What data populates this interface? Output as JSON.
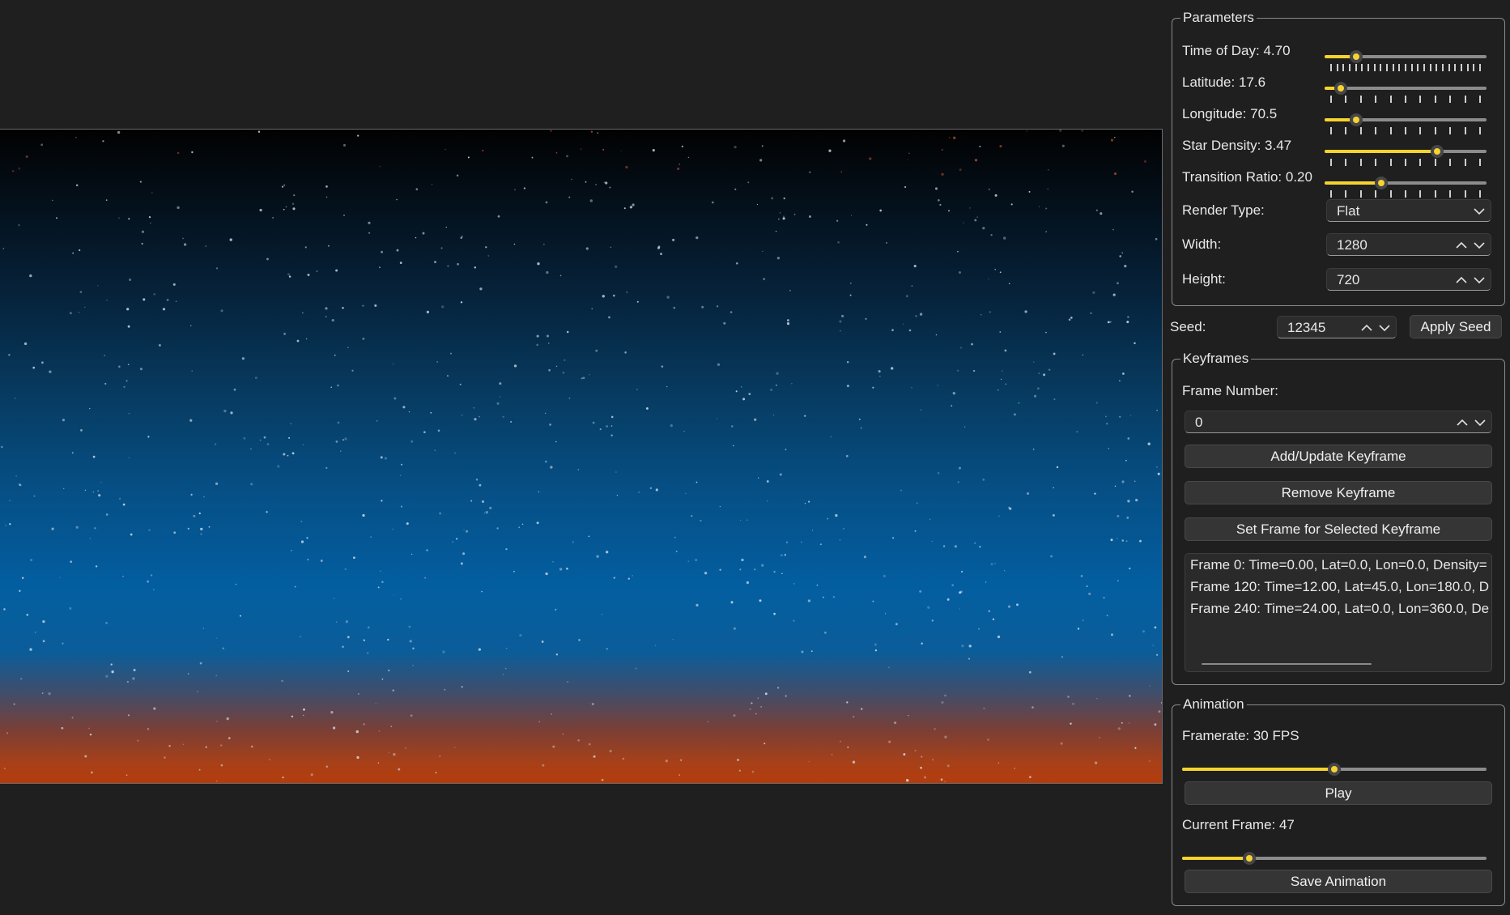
{
  "parameters": {
    "title": "Parameters",
    "sliders": [
      {
        "label": "Time of Day: 4.70",
        "value": 0.196,
        "ticks": 25
      },
      {
        "label": "Latitude: 17.6",
        "value": 0.098,
        "ticks": 11
      },
      {
        "label": "Longitude: 70.5",
        "value": 0.196,
        "ticks": 11
      },
      {
        "label": "Star Density: 3.47",
        "value": 0.694,
        "ticks": 11
      },
      {
        "label": "Transition Ratio: 0.20",
        "value": 0.35,
        "ticks": 11
      }
    ],
    "render_type": {
      "label": "Render Type:",
      "value": "Flat"
    },
    "width": {
      "label": "Width:",
      "value": "1280"
    },
    "height": {
      "label": "Height:",
      "value": "720"
    }
  },
  "seed": {
    "label": "Seed:",
    "value": "12345",
    "apply_label": "Apply Seed"
  },
  "keyframes": {
    "title": "Keyframes",
    "frame_number_label": "Frame Number:",
    "frame_number_value": "0",
    "add_update_label": "Add/Update Keyframe",
    "remove_label": "Remove Keyframe",
    "set_frame_label": "Set Frame for Selected Keyframe",
    "list": [
      "Frame 0: Time=0.00, Lat=0.0, Lon=0.0, Density=",
      "Frame 120: Time=12.00, Lat=45.0, Lon=180.0, D",
      "Frame 240: Time=24.00, Lat=0.0, Lon=360.0, De"
    ]
  },
  "animation": {
    "title": "Animation",
    "framerate_label": "Framerate: 30 FPS",
    "framerate_value": 0.5,
    "play_label": "Play",
    "current_frame_label": "Current Frame: 47",
    "current_frame_value": 0.22,
    "save_label": "Save Animation"
  },
  "colors": {
    "accent": "#f6d32d",
    "background": "#1f1f1f"
  }
}
